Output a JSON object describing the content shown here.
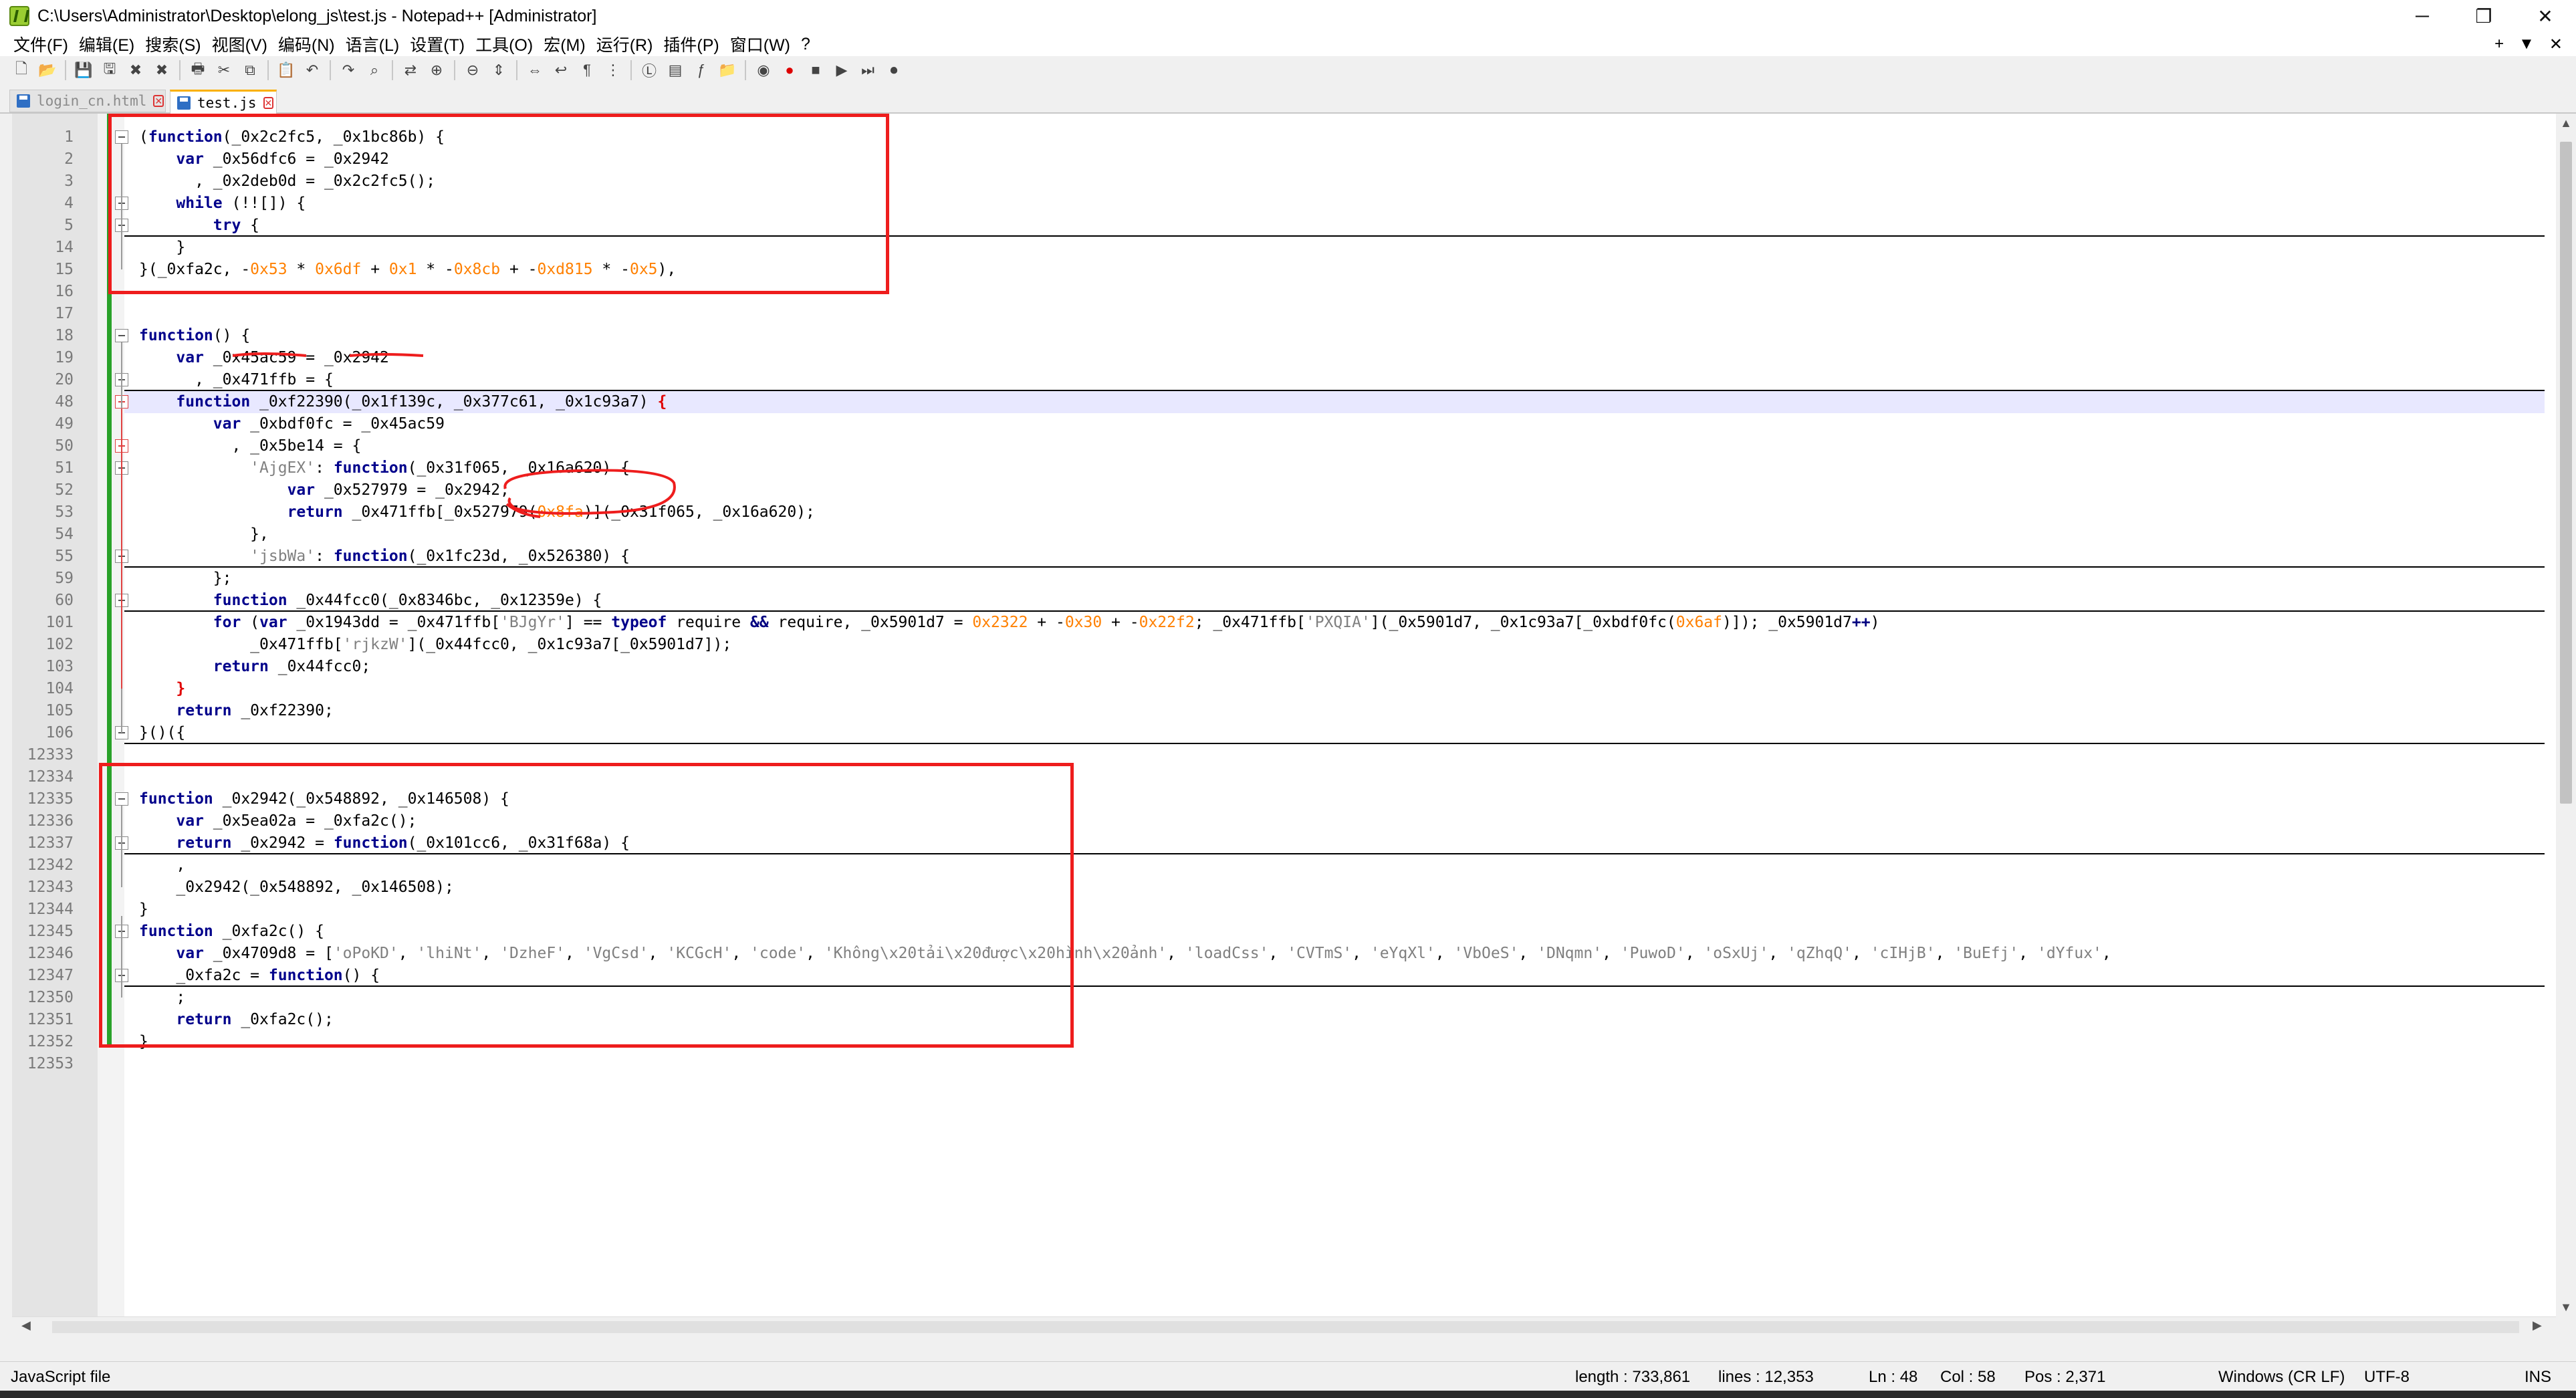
{
  "window": {
    "title": "C:\\Users\\Administrator\\Desktop\\elong_js\\test.js - Notepad++ [Administrator]",
    "controls": {
      "minimize": "─",
      "restore": "❐",
      "close": "✕"
    }
  },
  "menu": {
    "items": [
      "文件(F)",
      "编辑(E)",
      "搜索(S)",
      "视图(V)",
      "编码(N)",
      "语言(L)",
      "设置(T)",
      "工具(O)",
      "宏(M)",
      "运行(R)",
      "插件(P)",
      "窗口(W)",
      "?"
    ],
    "right": [
      "+",
      "▼",
      "✕"
    ]
  },
  "toolbar": {
    "buttons": [
      "new-file-icon",
      "open-file-icon",
      "save-icon",
      "save-all-icon",
      "close-icon",
      "close-all-icon",
      "print-icon",
      "cut-icon",
      "copy-icon",
      "paste-icon",
      "undo-icon",
      "redo-icon",
      "find-icon",
      "replace-icon",
      "zoom-in-icon",
      "zoom-out-icon",
      "sync-vertical-icon",
      "sync-horizontal-icon",
      "word-wrap-icon",
      "show-all-chars-icon",
      "indent-guide-icon",
      "language-icon",
      "doc-map-icon",
      "function-list-icon",
      "folder-workspace-icon",
      "monitor-icon",
      "record-macro-icon",
      "stop-macro-icon",
      "play-macro-icon",
      "run-macro-icon",
      "save-macro-icon"
    ]
  },
  "tabs": [
    {
      "label": "login_cn.html",
      "active": false
    },
    {
      "label": "test.js",
      "active": true
    }
  ],
  "editor": {
    "current_line": "48",
    "lines": [
      {
        "n": "1",
        "code": "(<kw>function</kw>(_0x2c2fc5, _0x1bc86b) {",
        "fold": "open"
      },
      {
        "n": "2",
        "code": "    <kw>var</kw> _0x56dfc6 = _0x2942"
      },
      {
        "n": "3",
        "code": "      , _0x2deb0d = _0x2c2fc5();"
      },
      {
        "n": "4",
        "code": "    <kw>while</kw> (!![]) {",
        "fold": "open"
      },
      {
        "n": "5",
        "code": "        <kw>try</kw> {",
        "fold": "closed"
      },
      {
        "n": "14",
        "code": "    }"
      },
      {
        "n": "15",
        "code": "}(_0xfa2c, -<num>0x53</num> * <num>0x6df</num> + <num>0x1</num> * -<num>0x8cb</num> + -<num>0xd815</num> * -<num>0x5</num>),"
      },
      {
        "n": "16",
        "code": ""
      },
      {
        "n": "17",
        "code": ""
      },
      {
        "n": "18",
        "code": "<kw>function</kw>() {",
        "fold": "open"
      },
      {
        "n": "19",
        "code": "    <kw>var</kw> _0x45ac59 = _0x2942"
      },
      {
        "n": "20",
        "code": "      , _0x471ffb = {",
        "fold": "closed"
      },
      {
        "n": "48",
        "code": "    <kw>function</kw> _0xf22390(_0x1f139c, _0x377c61, _0x1c93a7) <red>{</red>",
        "fold": "red"
      },
      {
        "n": "49",
        "code": "        <kw>var</kw> _0xbdf0fc = _0x45ac59"
      },
      {
        "n": "50",
        "code": "          , _0x5be14 = {",
        "fold": "red"
      },
      {
        "n": "51",
        "code": "            <str>'AjgEX'</str>: <kw>function</kw>(_0x31f065, _0x16a620) {",
        "fold": "open"
      },
      {
        "n": "52",
        "code": "                <kw>var</kw> _0x527979 = _0x2942;"
      },
      {
        "n": "53",
        "code": "                <kw>return</kw> _0x471ffb[_0x527979(<num>0x8fa</num>)](_0x31f065, _0x16a620);"
      },
      {
        "n": "54",
        "code": "            },"
      },
      {
        "n": "55",
        "code": "            <str>'jsbWa'</str>: <kw>function</kw>(_0x1fc23d, _0x526380) {",
        "fold": "closed"
      },
      {
        "n": "59",
        "code": "        };"
      },
      {
        "n": "60",
        "code": "        <kw>function</kw> _0x44fcc0(_0x8346bc, _0x12359e) {",
        "fold": "closed"
      },
      {
        "n": "101",
        "code": "        <kw>for</kw> (<kw>var</kw> _0x1943dd = _0x471ffb[<str>'BJgYr'</str>] == <kw>typeof</kw> require <op>&&</op> require, _0x5901d7 = <num>0x2322</num> + -<num>0x30</num> + -<num>0x22f2</num>; _0x471ffb[<str>'PXQIA'</str>](_0x5901d7, _0x1c93a7[_0xbdf0fc(<num>0x6af</num>)]); _0x5901d7<op>++</op>)"
      },
      {
        "n": "102",
        "code": "            _0x471ffb[<str>'rjkzW'</str>](_0x44fcc0, _0x1c93a7[_0x5901d7]);"
      },
      {
        "n": "103",
        "code": "        <kw>return</kw> _0x44fcc0;"
      },
      {
        "n": "104",
        "code": "    <red>}</red>"
      },
      {
        "n": "105",
        "code": "    <kw>return</kw> _0xf22390;"
      },
      {
        "n": "106",
        "code": "}()({",
        "fold": "closed"
      },
      {
        "n": "12333",
        "code": ""
      },
      {
        "n": "12334",
        "code": ""
      },
      {
        "n": "12335",
        "code": "<kw>function</kw> _0x2942(_0x548892, _0x146508) {",
        "fold": "open"
      },
      {
        "n": "12336",
        "code": "    <kw>var</kw> _0x5ea02a = _0xfa2c();"
      },
      {
        "n": "12337",
        "code": "    <kw>return</kw> _0x2942 = <kw>function</kw>(_0x101cc6, _0x31f68a) {",
        "fold": "closed"
      },
      {
        "n": "12342",
        "code": "    ,"
      },
      {
        "n": "12343",
        "code": "    _0x2942(_0x548892, _0x146508);"
      },
      {
        "n": "12344",
        "code": "}"
      },
      {
        "n": "12345",
        "code": "<kw>function</kw> _0xfa2c() {",
        "fold": "open"
      },
      {
        "n": "12346",
        "code": "    <kw>var</kw> _0x4709d8 = [<str>'oPoKD'</str>, <str>'lhiNt'</str>, <str>'DzheF'</str>, <str>'VgCsd'</str>, <str>'KCGcH'</str>, <str>'code'</str>, <str>'Không\\x20tải\\x20được\\x20hình\\x20ảnh'</str>, <str>'loadCss'</str>, <str>'CVTmS'</str>, <str>'eYqXl'</str>, <str>'VbOeS'</str>, <str>'DNqmn'</str>, <str>'PuwoD'</str>, <str>'oSxUj'</str>, <str>'qZhqQ'</str>, <str>'cIHjB'</str>, <str>'BuEfj'</str>, <str>'dYfux'</str>,"
      },
      {
        "n": "12347",
        "code": "    _0xfa2c = <kw>function</kw>() {",
        "fold": "closed"
      },
      {
        "n": "12350",
        "code": "    ;"
      },
      {
        "n": "12351",
        "code": "    <kw>return</kw> _0xfa2c();"
      },
      {
        "n": "12352",
        "code": "}"
      },
      {
        "n": "12353",
        "code": ""
      }
    ]
  },
  "status": {
    "file_type": "JavaScript file",
    "length": "length : 733,861",
    "lines": "lines : 12,353",
    "ln": "Ln : 48",
    "col": "Col : 58",
    "pos": "Pos : 2,371",
    "eol": "Windows (CR LF)",
    "encoding": "UTF-8",
    "mode": "INS"
  },
  "colors": {
    "keyword": "#00008b",
    "number": "#ff8000",
    "string": "#808080",
    "annotation": "#ee1d1d",
    "change_bar": "#2aa22a",
    "current_line": "#e8e8ff"
  }
}
